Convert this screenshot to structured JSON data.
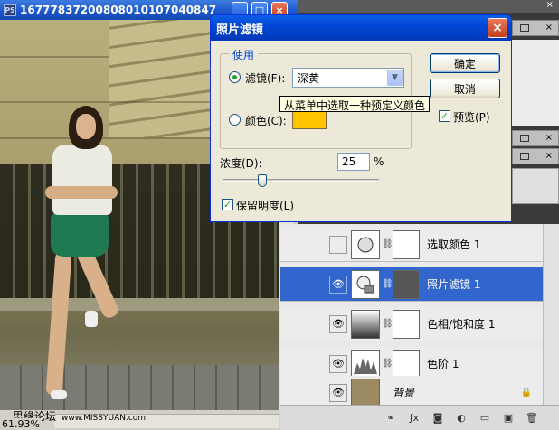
{
  "document": {
    "title": "16777837200808010107040847",
    "ps_icon": "PS",
    "zoom": "61.93%",
    "watermark": "思缘论坛",
    "watermark_url": "www.MISSYUAN.com",
    "min_btn": "_",
    "max_btn": "□",
    "close_btn": "×"
  },
  "dialog": {
    "title": "照片滤镜",
    "close_btn": "×",
    "group_label": "使用",
    "filter_label": "滤镜(F):",
    "filter_value": "深黄",
    "tooltip": "从菜单中选取一种预定义颜色",
    "color_label": "颜色(C):",
    "color_value": "#ffc400",
    "density_label": "浓度(D):",
    "density_value": "25",
    "density_unit": "%",
    "density_fraction": 0.25,
    "preserve_label": "保留明度(L)",
    "preserve_checked": true,
    "ok_label": "确定",
    "cancel_label": "取消",
    "preview_label": "预览(P)",
    "preview_checked": true,
    "selected_option": "filter"
  },
  "layers": {
    "items": [
      {
        "name": "选取颜色 1",
        "visible": false,
        "selected": false,
        "type": "adjustment"
      },
      {
        "name": "照片滤镜 1",
        "visible": true,
        "selected": true,
        "type": "photo-filter"
      },
      {
        "name": "色相/饱和度 1",
        "visible": true,
        "selected": false,
        "type": "hue-saturation"
      },
      {
        "name": "色阶 1",
        "visible": true,
        "selected": false,
        "type": "levels"
      },
      {
        "name": "背景",
        "visible": true,
        "selected": false,
        "type": "background",
        "locked": true
      }
    ],
    "footer_icons": [
      "link-icon",
      "fx-icon",
      "mask-icon",
      "adjustment-icon",
      "folder-icon",
      "new-layer-icon",
      "trash-icon"
    ]
  },
  "panel": {
    "close_glyph": "×"
  }
}
